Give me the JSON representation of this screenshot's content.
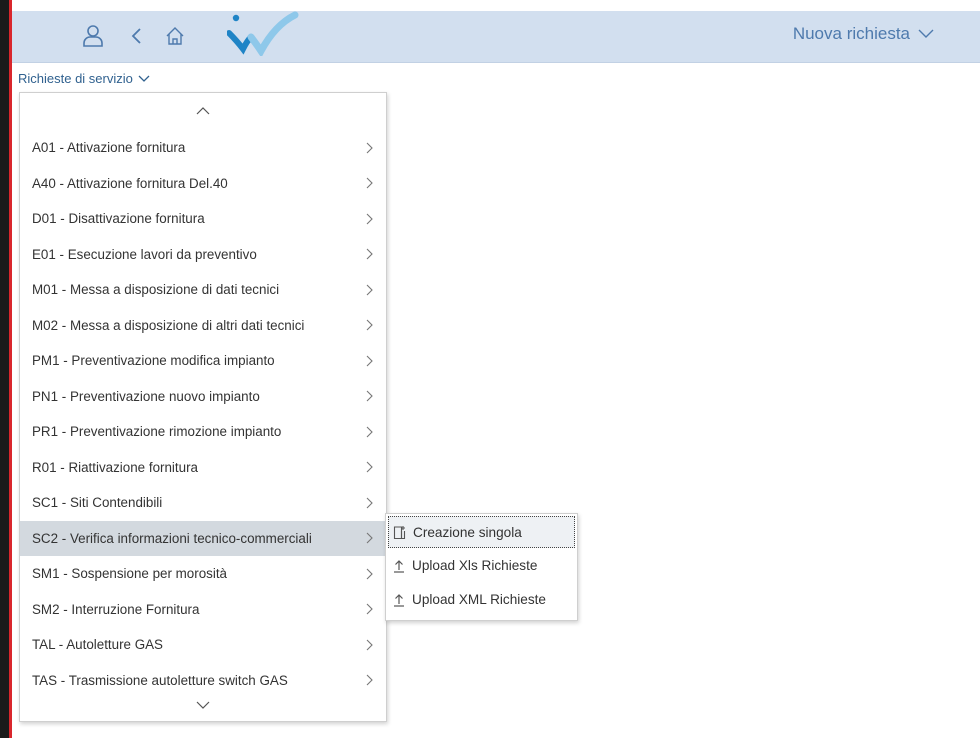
{
  "header": {
    "title": "Nuova richiesta",
    "icons": {
      "user": "user-icon",
      "back": "back-icon",
      "home": "home-icon",
      "logo": "logo-check-icon",
      "dropdown": "chevron-down-icon"
    },
    "colors": {
      "bar": "#d2dfef",
      "title": "#4e7aad",
      "logo_blue": "#1f84c6",
      "logo_light": "#8ec8ea"
    }
  },
  "subheader": {
    "label": "Richieste di servizio"
  },
  "menu": {
    "items": [
      {
        "label": "A01 - Attivazione fornitura"
      },
      {
        "label": "A40 - Attivazione fornitura   Del.40"
      },
      {
        "label": "D01 - Disattivazione fornitura"
      },
      {
        "label": "E01 - Esecuzione lavori da preventivo"
      },
      {
        "label": "M01 - Messa a disposizione di dati tecnici"
      },
      {
        "label": "M02 - Messa a disposizione di altri dati tecnici"
      },
      {
        "label": "PM1 - Preventivazione modifica impianto"
      },
      {
        "label": "PN1 - Preventivazione nuovo impianto"
      },
      {
        "label": "PR1 - Preventivazione rimozione impianto"
      },
      {
        "label": "R01 - Riattivazione fornitura"
      },
      {
        "label": "SC1 - Siti Contendibili"
      },
      {
        "label": "SC2 - Verifica informazioni tecnico-commerciali",
        "active": true
      },
      {
        "label": "SM1 - Sospensione per morosità"
      },
      {
        "label": "SM2 - Interruzione Fornitura"
      },
      {
        "label": "TAL - Autoletture GAS"
      },
      {
        "label": "TAS - Trasmissione autoletture switch GAS"
      }
    ]
  },
  "submenu": {
    "items": [
      {
        "label": "Creazione singola",
        "icon": "new-document-icon"
      },
      {
        "label": "Upload Xls Richieste",
        "icon": "upload-icon"
      },
      {
        "label": "Upload XML Richieste",
        "icon": "upload-icon"
      }
    ]
  }
}
